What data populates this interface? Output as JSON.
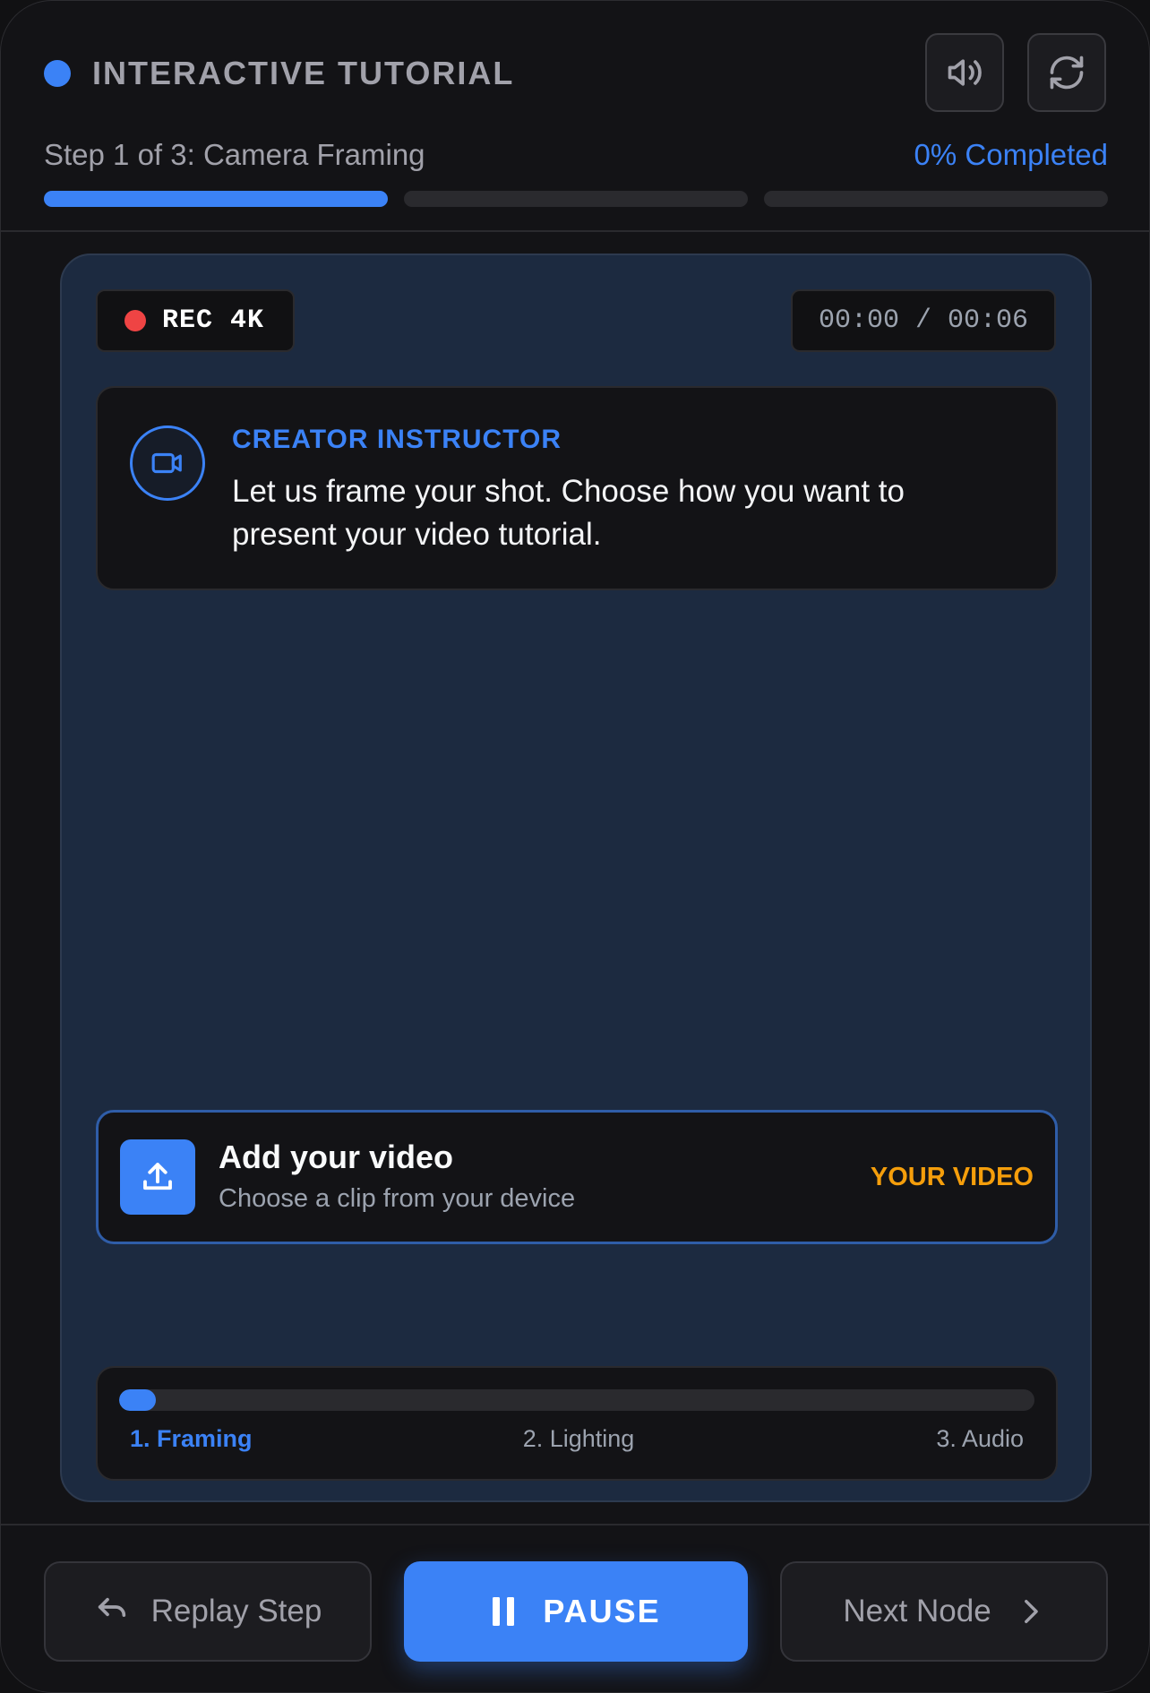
{
  "colors": {
    "accent": "#3b82f6",
    "record": "#ef4444",
    "tag": "#f59e0b",
    "panel": "#1c2a40",
    "background": "#131316"
  },
  "header": {
    "title": "INTERACTIVE TUTORIAL",
    "step_label": "Step 1 of 3: Camera Framing",
    "completed_label": "0% Completed",
    "steps_total": 3,
    "current_step": 1,
    "icons": {
      "sound": "speaker-icon",
      "refresh": "refresh-icon"
    }
  },
  "player": {
    "rec_label": "REC 4K",
    "timer": "00:00 / 00:06",
    "instructor": {
      "icon": "video-camera-icon",
      "role": "CREATOR INSTRUCTOR",
      "message": "Let us frame your shot. Choose how you want to present your video tutorial."
    },
    "upload": {
      "icon": "upload-icon",
      "title": "Add your video",
      "subtitle": "Choose a clip from your device",
      "tag": "YOUR VIDEO"
    },
    "timeline": {
      "progress_fraction": 0.04,
      "labels": [
        "1. Framing",
        "2. Lighting",
        "3. Audio"
      ]
    }
  },
  "footer": {
    "replay_label": "Replay Step",
    "pause_label": "PAUSE",
    "next_label": "Next Node"
  }
}
